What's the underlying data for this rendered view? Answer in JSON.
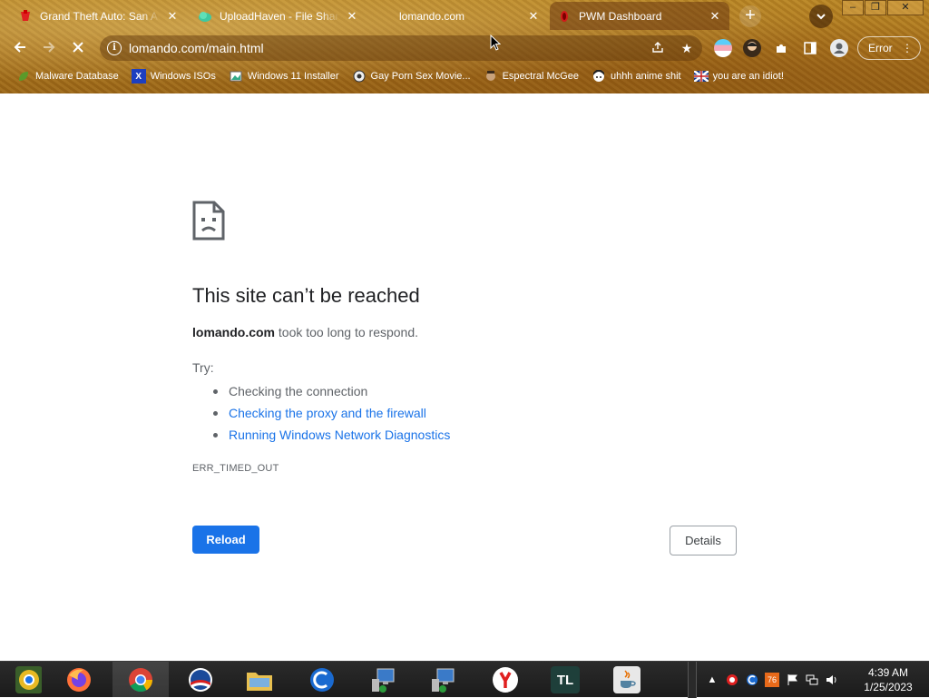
{
  "tabs": [
    {
      "title": "Grand Theft Auto: San Andreas",
      "icon": "gta-favicon",
      "active": false
    },
    {
      "title": "UploadHaven - File Sharing",
      "icon": "uploadhaven-favicon",
      "active": false
    },
    {
      "title": "lomando.com",
      "icon": "loading-icon",
      "active": true
    },
    {
      "title": "PWM Dashboard",
      "icon": "pwm-favicon",
      "active": false
    }
  ],
  "new_tab": "+",
  "window_controls": {
    "minimize": "–",
    "maximize": "❐",
    "close": "✕"
  },
  "toolbar": {
    "url": "lomando.com/main.html",
    "profile_status": "Error"
  },
  "bookmarks": [
    {
      "label": "Malware Database",
      "icon": "leaf-icon"
    },
    {
      "label": "Windows ISOs",
      "icon": "x-icon"
    },
    {
      "label": "Windows 11 Installer",
      "icon": "image-icon"
    },
    {
      "label": "Gay Porn Sex Movie...",
      "icon": "site-icon"
    },
    {
      "label": "Espectral McGee",
      "icon": "character-icon"
    },
    {
      "label": "uhhh anime shit",
      "icon": "anime-icon"
    },
    {
      "label": "you are an idiot!",
      "icon": "flag-icon"
    }
  ],
  "error_page": {
    "title": "This site can’t be reached",
    "host": "lomando.com",
    "message": " took too long to respond.",
    "try_label": "Try:",
    "suggestions": [
      "Checking the connection",
      "Checking the proxy and the firewall",
      "Running Windows Network Diagnostics"
    ],
    "error_code": "ERR_TIMED_OUT",
    "reload_label": "Reload",
    "details_label": "Details"
  },
  "taskbar": {
    "apps": [
      "chrome-canary",
      "firefox",
      "chrome",
      "obama-app",
      "file-explorer",
      "ccleaner",
      "network-tool-1",
      "network-tool-2",
      "yandex",
      "tl-app",
      "java"
    ],
    "tl_label": "TL",
    "tray_badge": "76",
    "time": "4:39 AM",
    "date": "1/25/2023"
  },
  "colors": {
    "accent": "#1a73e8",
    "frame": "#a9731c",
    "taskbar": "#1f1f1f"
  }
}
